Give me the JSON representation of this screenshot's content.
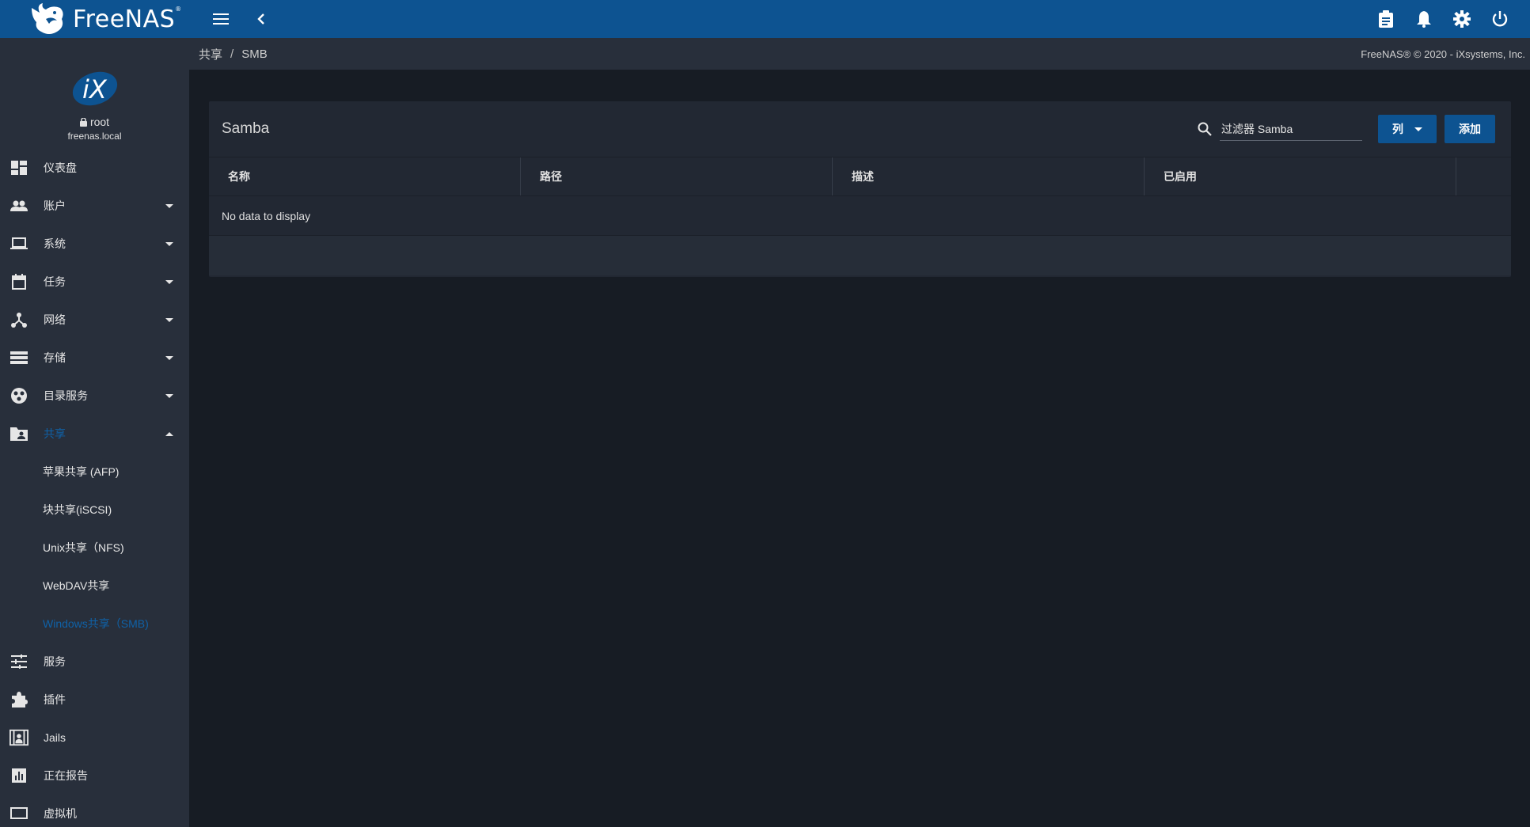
{
  "app": {
    "logo_text": "FreeNAS",
    "logo_tm": "®"
  },
  "topbar": {
    "icons": [
      "menu-icon",
      "chevron-left-icon",
      "clipboard-icon",
      "bell-icon",
      "gear-icon",
      "power-icon"
    ]
  },
  "profile": {
    "username": "root",
    "hostname": "freenas.local"
  },
  "sidebar": {
    "items": [
      {
        "label": "仪表盘",
        "icon": "dashboard-icon"
      },
      {
        "label": "账户",
        "icon": "people-icon"
      },
      {
        "label": "系统",
        "icon": "laptop-icon"
      },
      {
        "label": "任务",
        "icon": "calendar-icon"
      },
      {
        "label": "网络",
        "icon": "network-icon"
      },
      {
        "label": "存储",
        "icon": "storage-icon"
      },
      {
        "label": "目录服务",
        "icon": "directory-icon"
      },
      {
        "label": "共享",
        "icon": "folder-shared-icon"
      },
      {
        "label": "服务",
        "icon": "tune-icon"
      },
      {
        "label": "插件",
        "icon": "puzzle-icon"
      },
      {
        "label": "Jails",
        "icon": "jail-icon"
      },
      {
        "label": "正在报告",
        "icon": "report-icon"
      },
      {
        "label": "虚拟机",
        "icon": "vm-icon"
      }
    ],
    "sharing_sub": [
      {
        "label": "苹果共享 (AFP)"
      },
      {
        "label": "块共享(iSCSI)"
      },
      {
        "label": "Unix共享（NFS)"
      },
      {
        "label": "WebDAV共享"
      },
      {
        "label": "Windows共享（SMB)"
      }
    ]
  },
  "breadcrumb": {
    "parent": "共享",
    "separator": "/",
    "current": "SMB"
  },
  "copyright": "FreeNAS® © 2020 - iXsystems, Inc.",
  "card": {
    "title": "Samba",
    "filter_placeholder": "过滤器 Samba",
    "columns_button": "列",
    "add_button": "添加",
    "columns": [
      "名称",
      "路径",
      "描述",
      "已启用"
    ],
    "empty_text": "No data to display"
  },
  "colors": {
    "topbar": "#0d5391",
    "sidebar": "#282f3b",
    "background": "#171c24",
    "accent": "#0f62a8"
  }
}
